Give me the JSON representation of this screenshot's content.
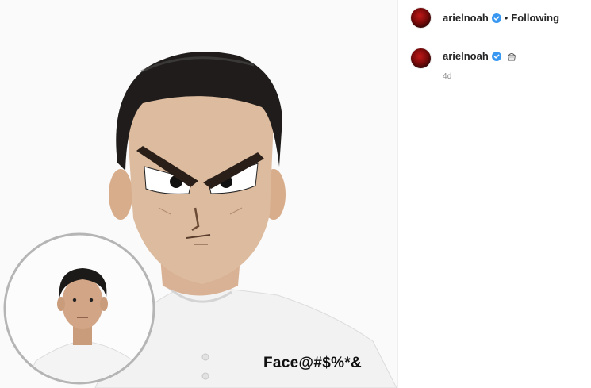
{
  "post": {
    "image_icon": "cartoon-face-meme-photo",
    "overlay_text": "Face@#$%*&"
  },
  "header": {
    "username": "arielnoah",
    "verified_icon": "verified-badge-icon",
    "separator": "•",
    "follow_status": "Following"
  },
  "caption": {
    "username": "arielnoah",
    "verified_icon": "verified-badge-icon",
    "emoji_icon": "cup-dessert-emoji",
    "timestamp": "4d"
  },
  "colors": {
    "verified": "#3897f0",
    "avatar": "#8b0c0c",
    "muted": "#8e8e8e"
  }
}
